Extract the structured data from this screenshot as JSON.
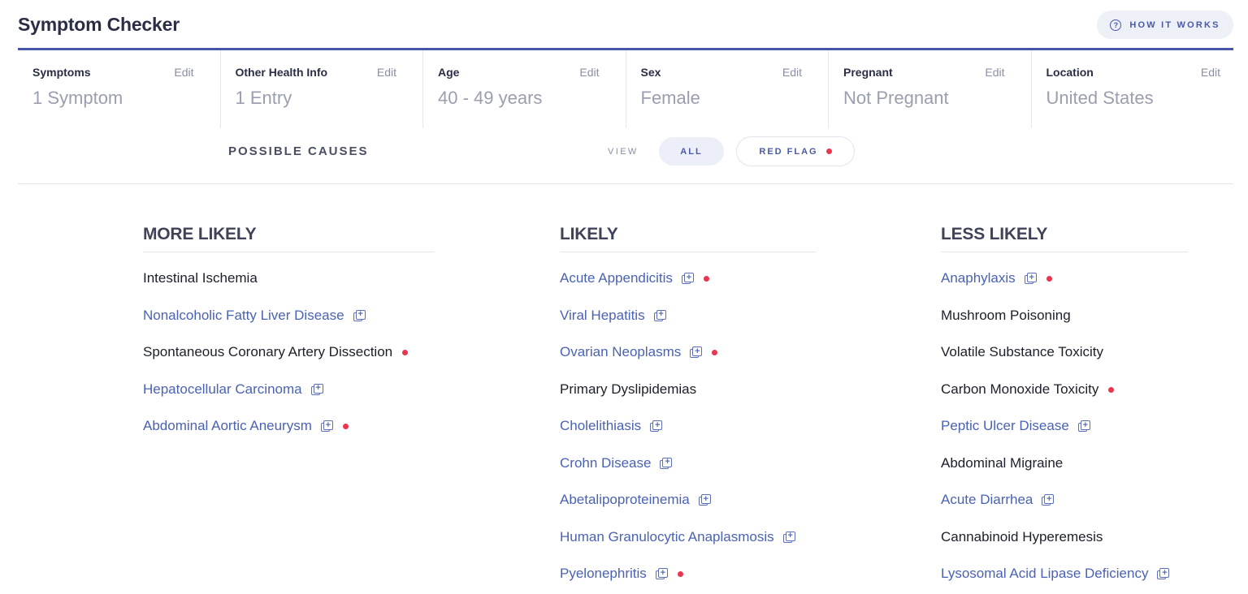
{
  "header": {
    "title": "Symptom Checker",
    "how_it_works": "HOW IT WORKS"
  },
  "info": [
    {
      "label": "Symptoms",
      "edit": "Edit",
      "value": "1 Symptom"
    },
    {
      "label": "Other Health Info",
      "edit": "Edit",
      "value": "1 Entry"
    },
    {
      "label": "Age",
      "edit": "Edit",
      "value": "40 - 49 years"
    },
    {
      "label": "Sex",
      "edit": "Edit",
      "value": "Female"
    },
    {
      "label": "Pregnant",
      "edit": "Edit",
      "value": "Not Pregnant"
    },
    {
      "label": "Location",
      "edit": "Edit",
      "value": "United States"
    }
  ],
  "filter": {
    "heading": "POSSIBLE CAUSES",
    "view_label": "VIEW",
    "all_label": "ALL",
    "red_flag_label": "RED FLAG"
  },
  "colors": {
    "accent": "#4756a8",
    "link": "#4a62b3",
    "red_flag": "#e8364e"
  },
  "columns": [
    {
      "heading": "MORE LIKELY",
      "items": [
        {
          "name": "Intestinal Ischemia",
          "link": false,
          "add": false,
          "red": false
        },
        {
          "name": "Nonalcoholic Fatty Liver Disease",
          "link": true,
          "add": true,
          "red": false
        },
        {
          "name": "Spontaneous Coronary Artery Dissection",
          "link": false,
          "add": false,
          "red": true
        },
        {
          "name": "Hepatocellular Carcinoma",
          "link": true,
          "add": true,
          "red": false
        },
        {
          "name": "Abdominal Aortic Aneurysm",
          "link": true,
          "add": true,
          "red": true
        }
      ]
    },
    {
      "heading": "LIKELY",
      "items": [
        {
          "name": "Acute Appendicitis",
          "link": true,
          "add": true,
          "red": true
        },
        {
          "name": "Viral Hepatitis",
          "link": true,
          "add": true,
          "red": false
        },
        {
          "name": "Ovarian Neoplasms",
          "link": true,
          "add": true,
          "red": true
        },
        {
          "name": "Primary Dyslipidemias",
          "link": false,
          "add": false,
          "red": false
        },
        {
          "name": "Cholelithiasis",
          "link": true,
          "add": true,
          "red": false
        },
        {
          "name": "Crohn Disease",
          "link": true,
          "add": true,
          "red": false
        },
        {
          "name": "Abetalipoproteinemia",
          "link": true,
          "add": true,
          "red": false
        },
        {
          "name": "Human Granulocytic Anaplasmosis",
          "link": true,
          "add": true,
          "red": false
        },
        {
          "name": "Pyelonephritis",
          "link": true,
          "add": true,
          "red": true
        }
      ]
    },
    {
      "heading": "LESS LIKELY",
      "items": [
        {
          "name": "Anaphylaxis",
          "link": true,
          "add": true,
          "red": true
        },
        {
          "name": "Mushroom Poisoning",
          "link": false,
          "add": false,
          "red": false
        },
        {
          "name": "Volatile Substance Toxicity",
          "link": false,
          "add": false,
          "red": false
        },
        {
          "name": "Carbon Monoxide Toxicity",
          "link": false,
          "add": false,
          "red": true
        },
        {
          "name": "Peptic Ulcer Disease",
          "link": true,
          "add": true,
          "red": false
        },
        {
          "name": "Abdominal Migraine",
          "link": false,
          "add": false,
          "red": false
        },
        {
          "name": "Acute Diarrhea",
          "link": true,
          "add": true,
          "red": false
        },
        {
          "name": "Cannabinoid Hyperemesis",
          "link": false,
          "add": false,
          "red": false
        },
        {
          "name": "Lysosomal Acid Lipase Deficiency",
          "link": true,
          "add": true,
          "red": false
        }
      ]
    }
  ]
}
